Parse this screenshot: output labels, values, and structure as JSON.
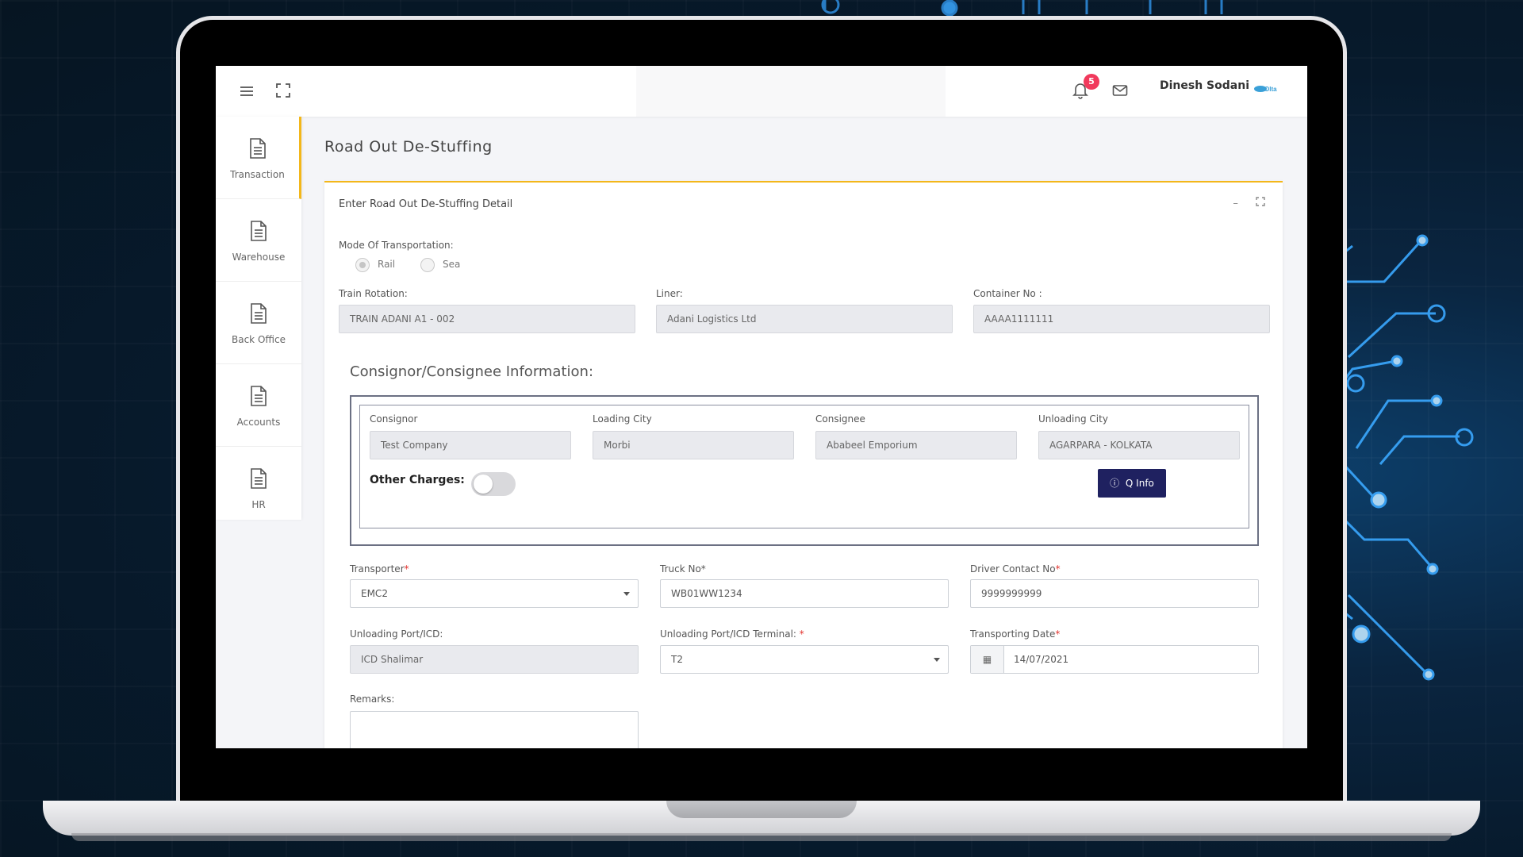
{
  "topbar": {
    "notification_count": "5",
    "username": "Dinesh Sodani",
    "logo_text": "Olta"
  },
  "sidebar": {
    "items": [
      {
        "label": "Transaction",
        "icon": "document-icon"
      },
      {
        "label": "Warehouse",
        "icon": "document-icon"
      },
      {
        "label": "Back Office",
        "icon": "document-icon"
      },
      {
        "label": "Accounts",
        "icon": "document-icon"
      },
      {
        "label": "HR",
        "icon": "document-icon"
      }
    ]
  },
  "page": {
    "title": "Road Out De-Stuffing",
    "card_title": "Enter Road Out De-Stuffing Detail"
  },
  "form": {
    "mode_label": "Mode Of Transportation:",
    "mode_options": [
      "Rail",
      "Sea"
    ],
    "mode_selected": "Rail",
    "train_rotation_label": "Train Rotation:",
    "train_rotation_value": "TRAIN ADANI A1 - 002",
    "liner_label": "Liner:",
    "liner_value": "Adani Logistics Ltd",
    "container_label": "Container No :",
    "container_value": "AAAA1111111",
    "section_title": "Consignor/Consignee Information:",
    "consignor_label": "Consignor",
    "consignor_value": "Test Company",
    "loading_city_label": "Loading City",
    "loading_city_value": "Morbi",
    "consignee_label": "Consignee",
    "consignee_value": "Ababeel Emporium",
    "unloading_city_label": "Unloading City",
    "unloading_city_value": "AGARPARA - KOLKATA",
    "other_charges_label": "Other Charges:",
    "other_charges_on": false,
    "qinfo_label": "Q Info",
    "transporter_label": "Transporter",
    "transporter_value": "EMC2",
    "truck_label": "Truck No",
    "truck_value": "WB01WW1234",
    "driver_label": "Driver Contact No",
    "driver_value": "9999999999",
    "unloading_port_label": "Unloading Port/ICD:",
    "unloading_port_value": "ICD Shalimar",
    "unloading_terminal_label": "Unloading Port/ICD Terminal: ",
    "unloading_terminal_value": "T2",
    "transport_date_label": "Transporting Date",
    "transport_date_value": "14/07/2021",
    "remarks_label": "Remarks:",
    "required_mark": "*"
  },
  "colors": {
    "accent": "#f3b71a",
    "primary_button": "#1f2160",
    "badge": "#f1395c"
  }
}
